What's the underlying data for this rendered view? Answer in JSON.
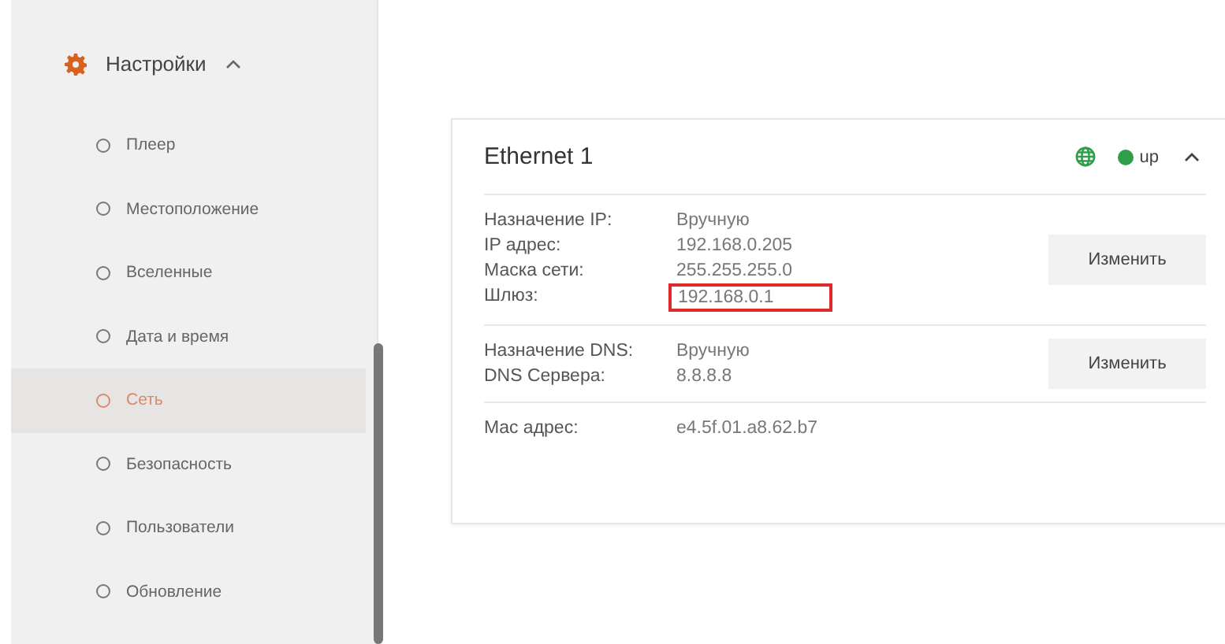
{
  "sidebar": {
    "section": {
      "label": "Настройки",
      "expanded": true
    },
    "items": [
      {
        "label": "Плеер",
        "selected": false
      },
      {
        "label": "Местоположение",
        "selected": false
      },
      {
        "label": "Вселенные",
        "selected": false
      },
      {
        "label": "Дата и время",
        "selected": false
      },
      {
        "label": "Сеть",
        "selected": true
      },
      {
        "label": "Безопасность",
        "selected": false
      },
      {
        "label": "Пользователи",
        "selected": false
      },
      {
        "label": "Обновление",
        "selected": false
      }
    ]
  },
  "card": {
    "title": "Ethernet 1",
    "link_up": true,
    "status": "up",
    "expanded": true,
    "groups": [
      {
        "rows": [
          {
            "label": "Назначение IP:",
            "value": "Вручную",
            "highlighted": false
          },
          {
            "label": "IP адрес:",
            "value": "192.168.0.205",
            "highlighted": false
          },
          {
            "label": "Маска сети:",
            "value": "255.255.255.0",
            "highlighted": false
          },
          {
            "label": "Шлюз:",
            "value": "192.168.0.1",
            "highlighted": true
          }
        ],
        "button": "Изменить"
      },
      {
        "rows": [
          {
            "label": "Назначение DNS:",
            "value": "Вручную",
            "highlighted": false
          },
          {
            "label": "DNS Сервера:",
            "value": "8.8.8.8",
            "highlighted": false
          }
        ],
        "button": "Изменить"
      },
      {
        "rows": [
          {
            "label": "Mac адрес:",
            "value": "e4.5f.01.a8.62.b7",
            "highlighted": false
          }
        ]
      }
    ]
  }
}
